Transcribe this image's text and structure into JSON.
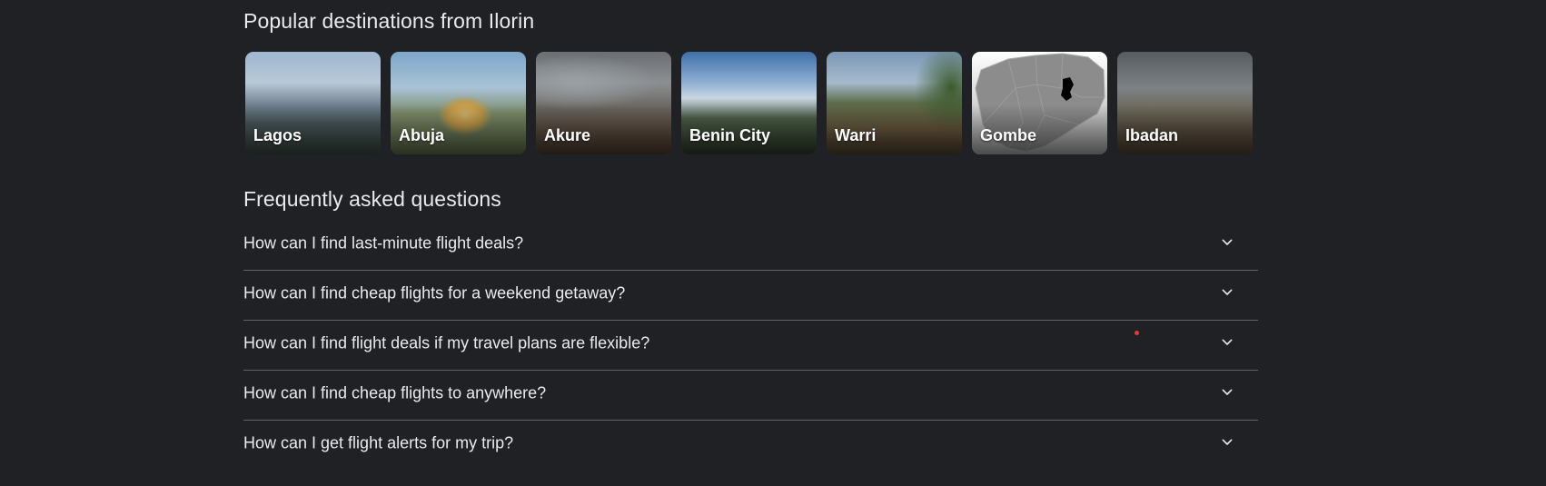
{
  "destinations": {
    "title": "Popular destinations from Ilorin",
    "items": [
      {
        "label": "Lagos"
      },
      {
        "label": "Abuja"
      },
      {
        "label": "Akure"
      },
      {
        "label": "Benin City"
      },
      {
        "label": "Warri"
      },
      {
        "label": "Gombe"
      },
      {
        "label": "Ibadan"
      }
    ]
  },
  "faq": {
    "title": "Frequently asked questions",
    "items": [
      {
        "question": "How can I find last-minute flight deals?",
        "icon": "chevron-down-icon"
      },
      {
        "question": "How can I find cheap flights for a weekend getaway?",
        "icon": "chevron-down-icon"
      },
      {
        "question": "How can I find flight deals if my travel plans are flexible?",
        "icon": "chevron-down-icon"
      },
      {
        "question": "How can I find cheap flights to anywhere?",
        "icon": "chevron-down-icon"
      },
      {
        "question": "How can I get flight alerts for my trip?",
        "icon": "chevron-down-icon"
      }
    ]
  },
  "colors": {
    "background": "#202124",
    "text": "#e8eaed",
    "divider": "#5f6368"
  }
}
